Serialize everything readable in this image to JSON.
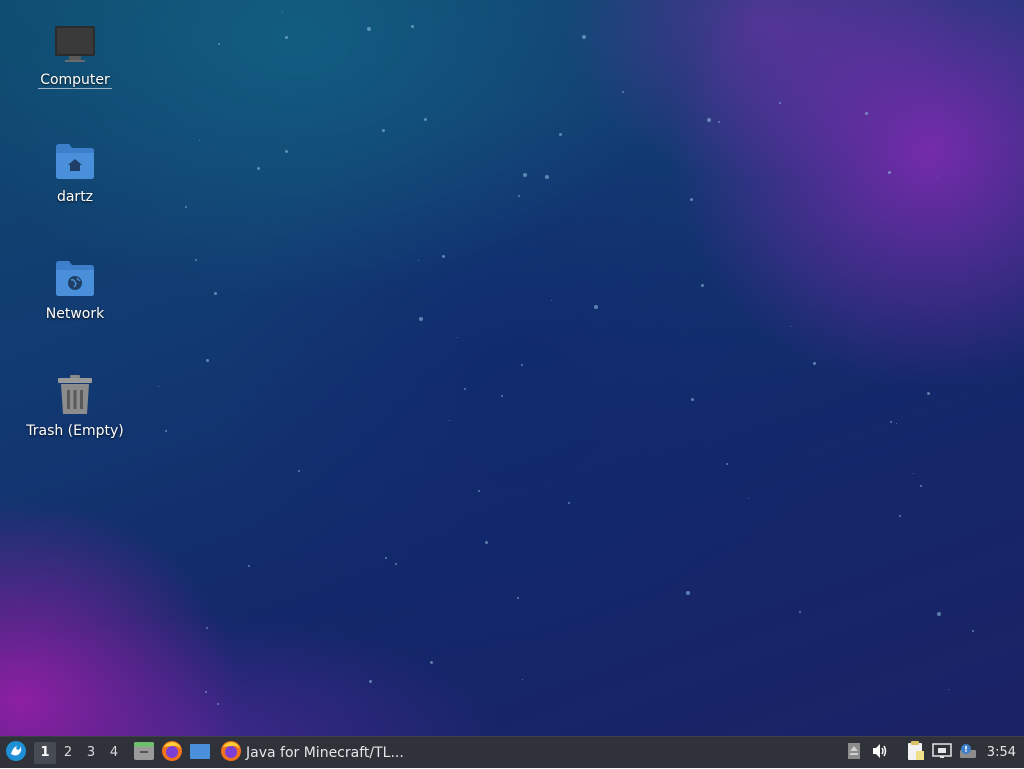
{
  "desktop": {
    "icons": [
      {
        "label": "Computer",
        "icon": "computer-icon"
      },
      {
        "label": "dartz",
        "icon": "home-folder-icon"
      },
      {
        "label": "Network",
        "icon": "network-folder-icon"
      },
      {
        "label": "Trash (Empty)",
        "icon": "trash-icon"
      }
    ]
  },
  "panel": {
    "menu_icon": "start-menu-icon",
    "workspaces": [
      "1",
      "2",
      "3",
      "4"
    ],
    "active_workspace": "1",
    "launchers": [
      "file-manager-icon",
      "firefox-icon",
      "show-desktop-icon"
    ],
    "task": {
      "title": "Java for Minecraft/TL...",
      "icon": "firefox-icon"
    },
    "tray": [
      "removable-drive-icon",
      "volume-icon",
      "clipboard-icon",
      "network-wired-icon",
      "update-notifier-icon"
    ],
    "clock": "3:54"
  },
  "colors": {
    "panel_bg": "#2f3238",
    "folder_blue": "#4a8fd9",
    "firefox_orange": "#f2731c"
  }
}
